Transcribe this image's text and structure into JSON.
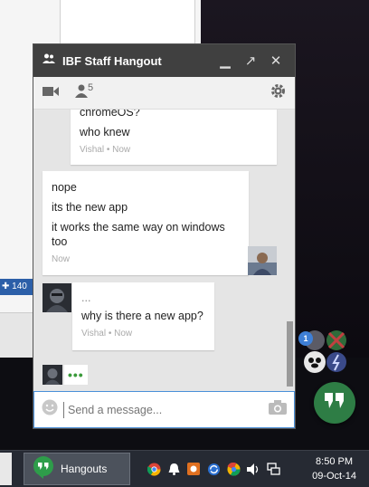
{
  "desktop": {
    "side_bar_text": "140"
  },
  "window": {
    "title": "IBF Staff Hangout",
    "participant_count": "5"
  },
  "messages": [
    {
      "lines": [
        "chromeOS?",
        "who knew"
      ],
      "meta": "Vishal • Now"
    },
    {
      "lines": [
        "nope",
        "its the new app",
        "it works the same way on windows too"
      ],
      "meta": "Now"
    },
    {
      "lines": [
        "...",
        "why is there a new app?"
      ],
      "meta": "Vishal • Now"
    }
  ],
  "typing": {
    "dots": "•••"
  },
  "composer": {
    "placeholder": "Send a message..."
  },
  "floating": {
    "unread_badge": "1"
  },
  "taskbar": {
    "app_label": "Hangouts",
    "time": "8:50 PM",
    "date": "09-Oct-14"
  },
  "colors": {
    "titlebar": "#404040",
    "accent_green": "#2e7d45",
    "input_focus": "#4a90d9"
  }
}
